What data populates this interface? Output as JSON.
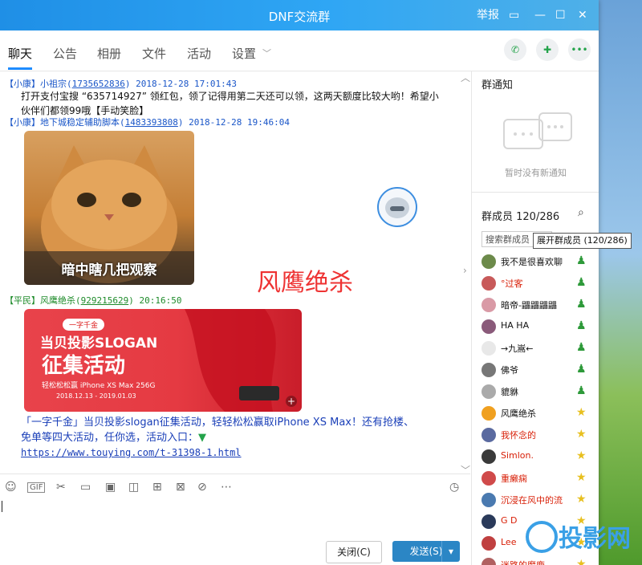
{
  "window": {
    "title": "DNF交流群",
    "report_label": "举报"
  },
  "tabs": [
    {
      "label": "聊天"
    },
    {
      "label": "公告"
    },
    {
      "label": "相册"
    },
    {
      "label": "文件"
    },
    {
      "label": "活动"
    },
    {
      "label": "设置"
    }
  ],
  "messages": {
    "m1": {
      "prefix": "【小康】",
      "name": "小祖宗",
      "qq": "1735652836",
      "time": "2018-12-28 17:01:43",
      "line1": "打开支付宝搜 “635714927” 领红包，领了记得用第二天还可以领，这两天额度比较大哟！希望小",
      "line2": "伙伴们都领99哦【手动笑脸】"
    },
    "m2": {
      "prefix": "【小康】",
      "name": "地下城稳定辅助脚本",
      "qq": "1483393808",
      "time": "2018-12-28 19:46:04",
      "image_caption": "暗中瞎几把观察"
    },
    "m3": {
      "prefix": "【平民】",
      "name": "风鹰绝杀",
      "qq": "929215629",
      "time": "20:16:50",
      "banner_tag": "一字千金",
      "banner_line1": "当贝投影SLOGAN",
      "banner_line2": "征集活动",
      "banner_line3": "轻松松松赢 iPhone XS Max 256G",
      "banner_date": "2018.12.13 - 2019.01.03",
      "text_line1": "「一字千金」当贝投影slogan征集活动，轻轻松松赢取iPhone XS Max！还有抢楼、",
      "text_line2": "免单等四大活动，任你选，活动入口：",
      "link": "https://www.touying.com/t-31398-1.html"
    }
  },
  "overlay_text": "风鹰绝杀",
  "buttons": {
    "close": "关闭(C)",
    "send": "发送(S)"
  },
  "right_panel": {
    "notice_title": "群通知",
    "notice_empty": "暂时没有新通知",
    "members_title": "群成员 120/286",
    "member_search_placeholder": "搜索群成员",
    "tooltip": "展开群成员 (120/286)",
    "members": [
      {
        "name": "我不是很喜欢聊",
        "color": "#111111"
      },
      {
        "name": "°过客",
        "color": "#d81e06"
      },
      {
        "name": "暗帝-鼺鼺鼺鼺",
        "color": "#111111"
      },
      {
        "name": "HA HA",
        "color": "#111111"
      },
      {
        "name": "→九嵩←",
        "color": "#111111"
      },
      {
        "name": "佛爷",
        "color": "#111111"
      },
      {
        "name": "貔貅",
        "color": "#111111"
      },
      {
        "name": "风鹰绝杀",
        "color": "#111111"
      },
      {
        "name": "我怀念的",
        "color": "#d81e06"
      },
      {
        "name": "Simlon.",
        "color": "#d81e06"
      },
      {
        "name": "重癞痫",
        "color": "#d81e06"
      },
      {
        "name": "沉浸在风中的流",
        "color": "#d81e06"
      },
      {
        "name": "G  D",
        "color": "#d81e06"
      },
      {
        "name": "Lee",
        "color": "#d81e06"
      },
      {
        "name": "迷路的魔鹿",
        "color": "#d81e06"
      }
    ]
  },
  "bottom_logo_text": "投影网"
}
